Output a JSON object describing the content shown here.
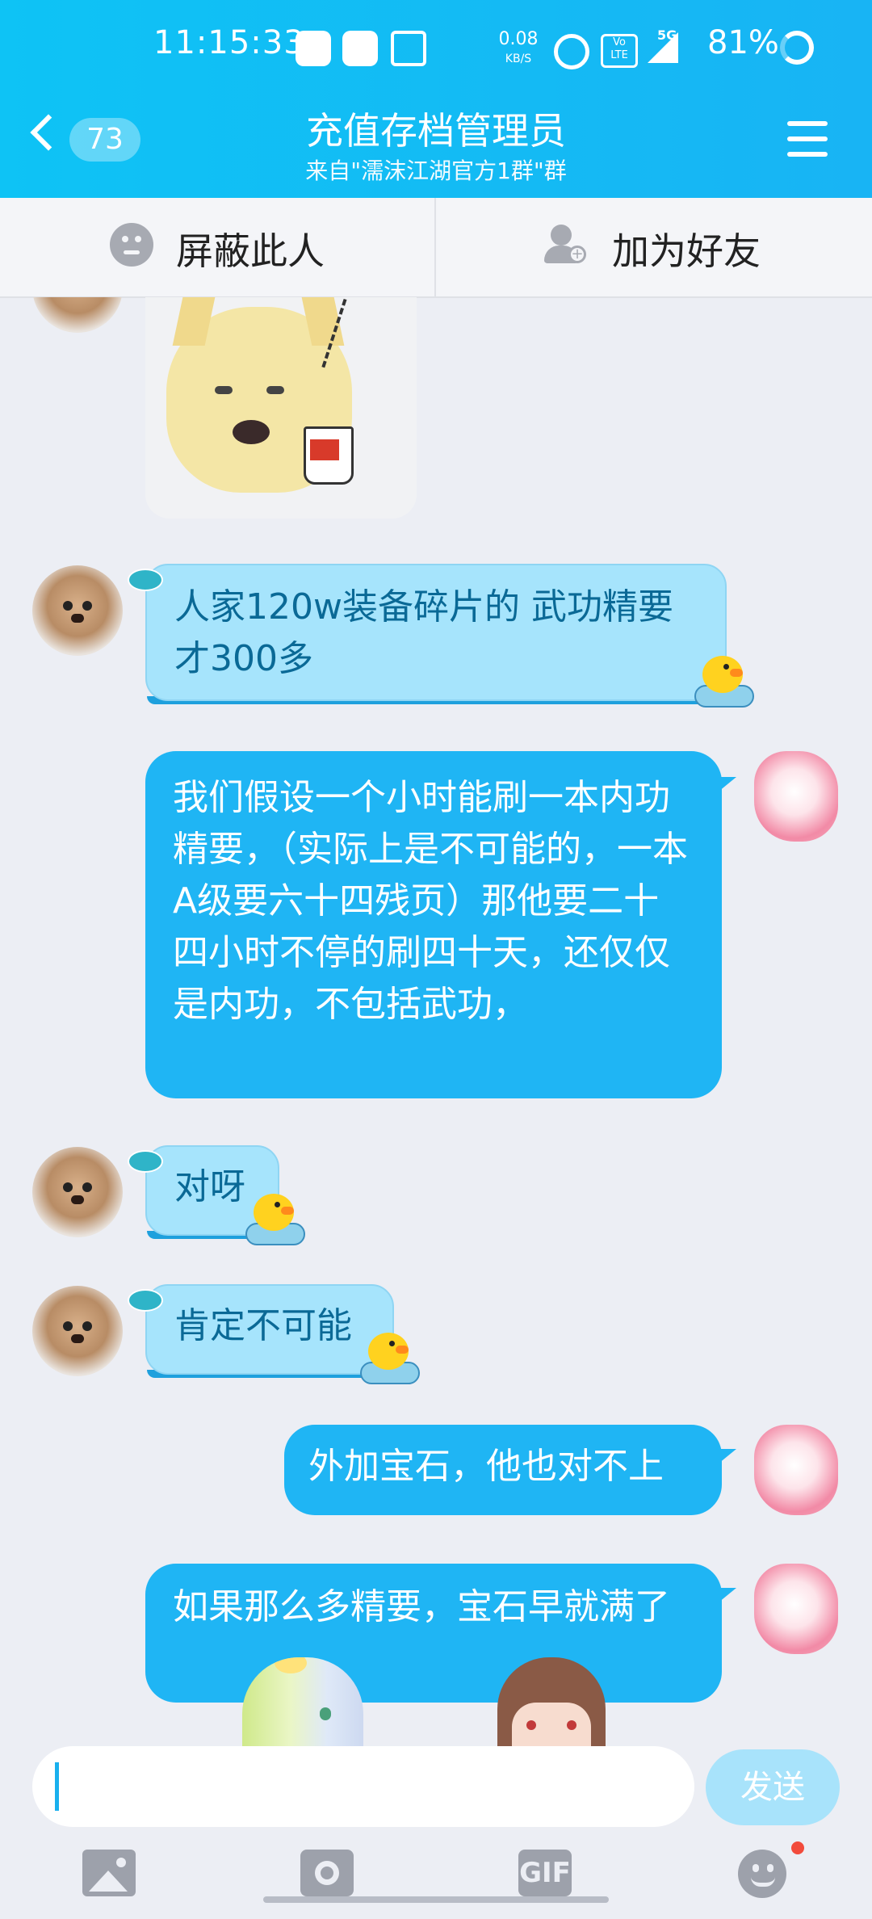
{
  "status_bar": {
    "time": "11:15:33",
    "net_speed": "0.08",
    "net_unit": "KB/S",
    "volte": "Vo LTE",
    "signal": "5G",
    "battery": "81%"
  },
  "header": {
    "back_badge": "73",
    "title": "充值存档管理员",
    "subtitle": "来自\"濡沫江湖官方1群\"群"
  },
  "actions": {
    "block_label": "屏蔽此人",
    "add_friend_label": "加为好友"
  },
  "messages": [
    {
      "side": "in",
      "text": "人家120w装备碎片的 武功精要才300多"
    },
    {
      "side": "out",
      "text": "我们假设一个小时能刷一本内功精要，（实际上是不可能的，一本A级要六十四残页）那他要二十四小时不停的刷四十天，还仅仅是内功，不包括武功，"
    },
    {
      "side": "in",
      "text": "对呀"
    },
    {
      "side": "in",
      "text": "肯定不可能"
    },
    {
      "side": "out",
      "text": "外加宝石，他也对不上"
    },
    {
      "side": "out",
      "text": "如果那么多精要，宝石早就满了"
    }
  ],
  "input": {
    "value": "",
    "send_label": "发送"
  },
  "toolbar": {
    "icons": [
      "image-icon",
      "camera-icon",
      "gif-icon",
      "emoji-icon"
    ],
    "gif_label": "GIF"
  },
  "colors": {
    "header": "#18b4f4",
    "bubble_out": "#1fb5f4",
    "bubble_in": "#a6e4fc",
    "send_button": "#a8e3fb"
  }
}
